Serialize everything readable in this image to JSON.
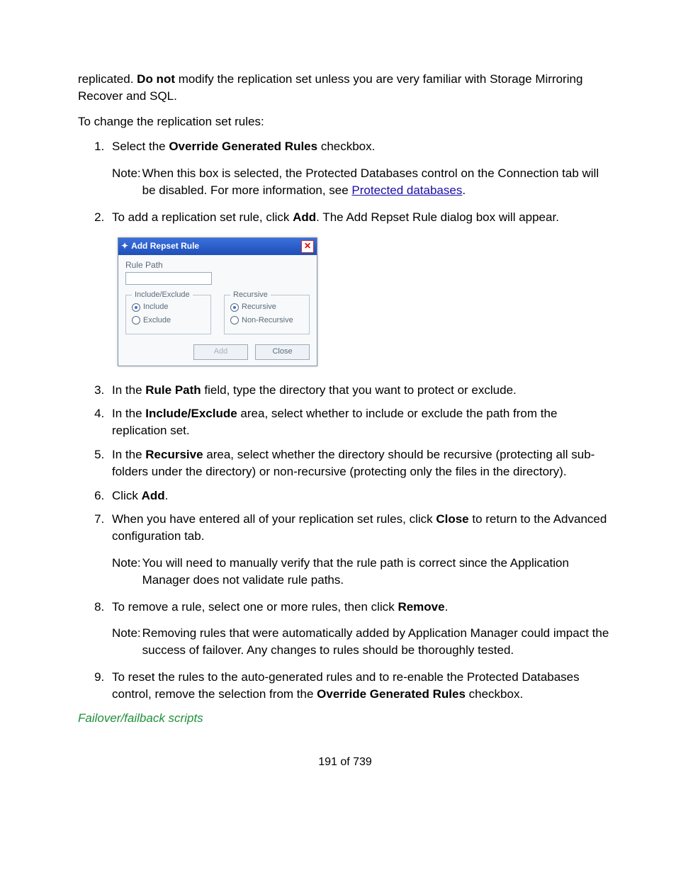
{
  "intro": {
    "p1_a": "replicated. ",
    "p1_bold": "Do not",
    "p1_b": " modify the replication set unless you are very familiar with Storage Mirroring Recover and SQL.",
    "p2": "To change the replication set rules:"
  },
  "list": {
    "i1_a": "Select the ",
    "i1_bold": "Override Generated Rules",
    "i1_b": " checkbox.",
    "note1_label": "Note:",
    "note1_a": "When this box is selected, the Protected Databases control on the Connection tab will be disabled. For more information, see ",
    "note1_link": "Protected databases",
    "note1_b": ".",
    "i2_a": "To add a replication set rule, click ",
    "i2_bold": "Add",
    "i2_b": ". The Add Repset Rule dialog box will appear.",
    "i3_a": "In the ",
    "i3_bold": "Rule Path",
    "i3_b": " field, type the directory that you want to protect or exclude.",
    "i4_a": "In the ",
    "i4_bold": "Include/Exclude",
    "i4_b": " area, select whether to include or exclude the path from the replication set.",
    "i5_a": "In the ",
    "i5_bold": "Recursive",
    "i5_b": " area, select whether the directory should be recursive (protecting all sub-folders under the directory) or non-recursive (protecting only the files in the directory).",
    "i6_a": "Click ",
    "i6_bold": "Add",
    "i6_b": ".",
    "i7_a": "When you have entered all of your replication set rules, click ",
    "i7_bold": "Close",
    "i7_b": " to return to the Advanced configuration tab.",
    "note2_label": "Note:",
    "note2_text": "You will need to manually verify that the rule path is correct since the Application Manager does not validate rule paths.",
    "i8_a": "To remove a rule, select one or more rules, then click ",
    "i8_bold": "Remove",
    "i8_b": ".",
    "note3_label": "Note:",
    "note3_text": "Removing rules that were automatically added by Application Manager could impact the success of failover. Any changes to rules should be thoroughly tested.",
    "i9_a": "To reset the rules to the auto-generated rules and to re-enable the Protected Databases control, remove the selection from the ",
    "i9_bold": "Override Generated Rules",
    "i9_b": " checkbox."
  },
  "dialog": {
    "title": "Add Repset Rule",
    "rule_path_label": "Rule Path",
    "group1_legend": "Include/Exclude",
    "g1_opt1": "Include",
    "g1_opt2": "Exclude",
    "group2_legend": "Recursive",
    "g2_opt1": "Recursive",
    "g2_opt2": "Non-Recursive",
    "btn_add": "Add",
    "btn_close": "Close"
  },
  "section_heading": "Failover/failback scripts",
  "page_number": "191 of 739"
}
